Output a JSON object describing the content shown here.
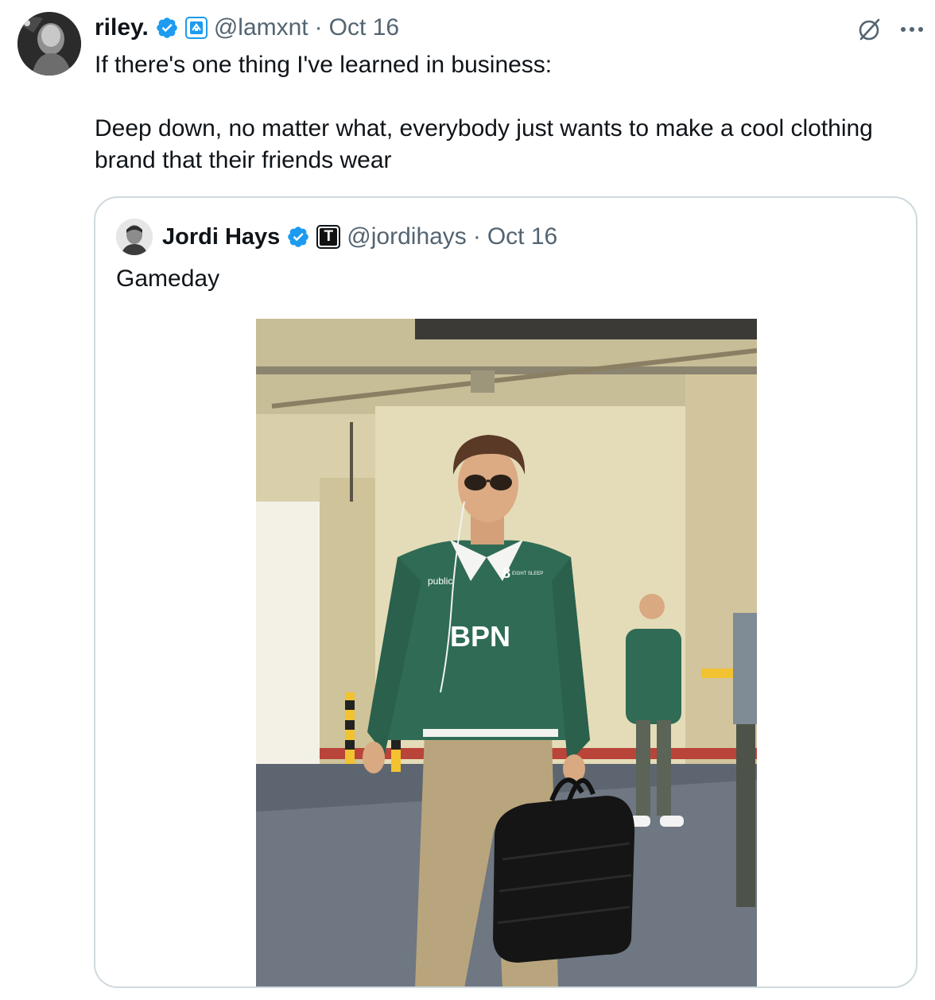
{
  "tweet": {
    "display_name": "riley.",
    "handle": "@lamxnt",
    "separator": "·",
    "date": "Oct 16",
    "paragraphs": [
      "If there's one thing I've learned in business:",
      "Deep down, no matter what, everybody just wants to make a cool clothing brand that their friends wear"
    ]
  },
  "quote": {
    "display_name": "Jordi Hays",
    "handle": "@jordihays",
    "separator": "·",
    "date": "Oct 16",
    "text": "Gameday",
    "affiliate_badge_letter": "T",
    "photo": {
      "shirt_text": "BPN",
      "logos": [
        "public",
        "8",
        "EIGHT SLEEP"
      ]
    }
  },
  "icons": {
    "verified": "verified-badge-icon",
    "affiliate": "affiliate-badge-icon",
    "grok": "grok-icon",
    "more": "more-icon"
  },
  "colors": {
    "verified_blue": "#1d9bf0",
    "text_primary": "#0f1419",
    "text_secondary": "#536471",
    "border": "#cfd9de",
    "jersey_green": "#2f6b55",
    "pants_khaki": "#b9a57d"
  }
}
